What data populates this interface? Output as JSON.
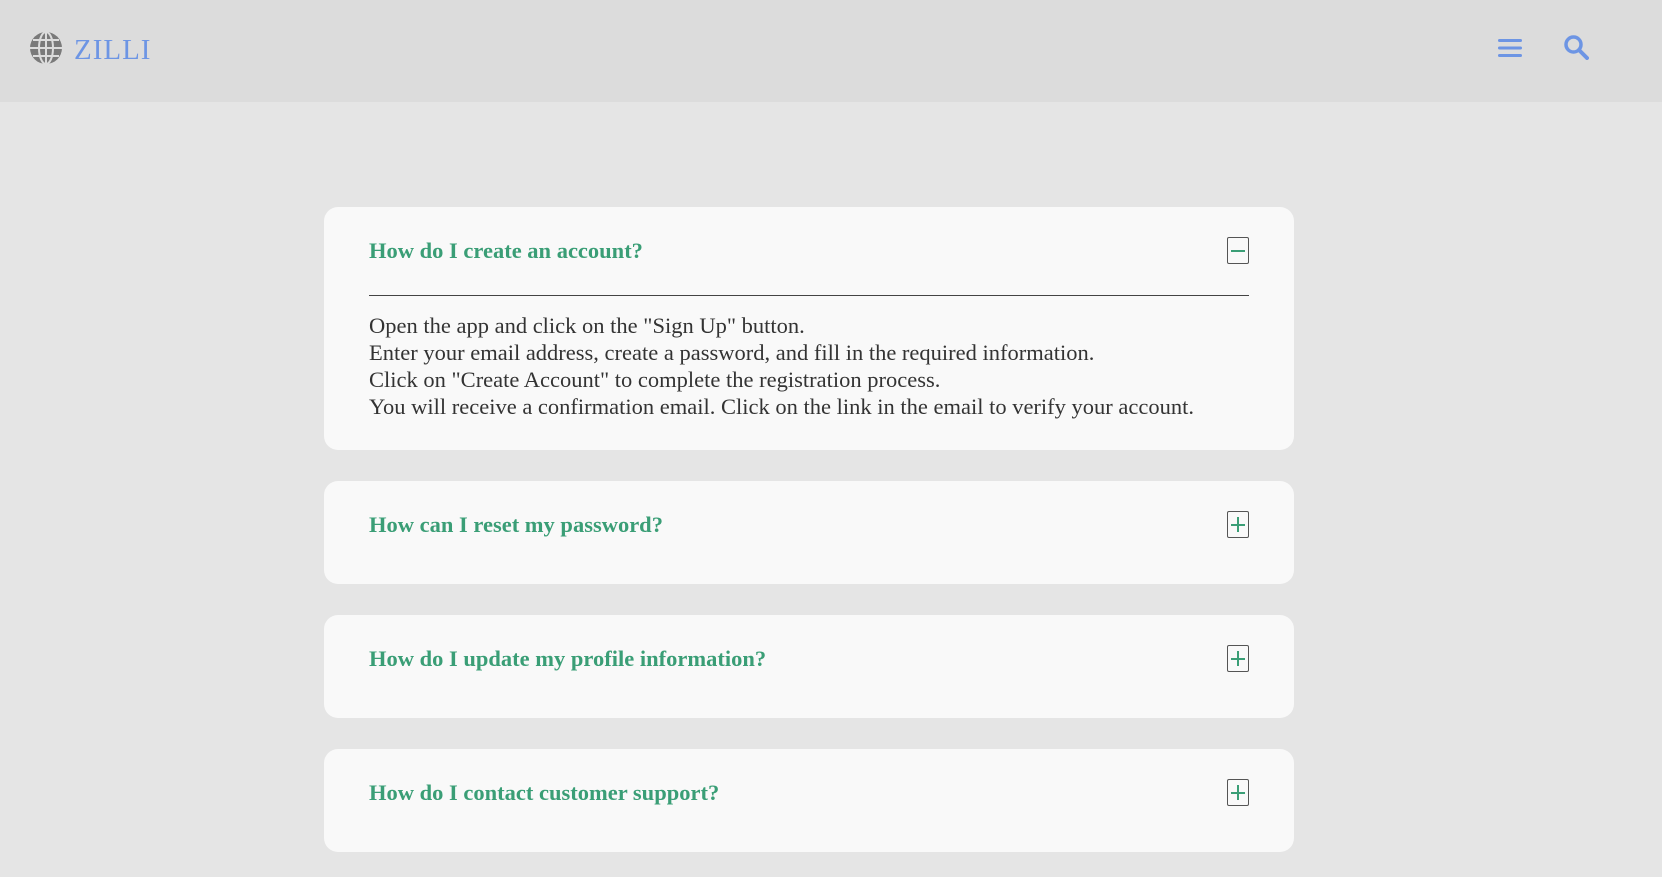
{
  "header": {
    "logo_text": "ZILLI",
    "logo_icon": "globe-icon",
    "menu_icon": "hamburger-menu-icon",
    "search_icon": "search-icon"
  },
  "colors": {
    "brand": "#6d95e4",
    "accent": "#3a9e76",
    "header_bg": "#dcdcdc",
    "page_bg": "#e5e5e5",
    "card_bg": "#f9f9f9"
  },
  "faq": [
    {
      "question": "How do I create an account?",
      "expanded": true,
      "answer": [
        "Open the app and click on the \"Sign Up\" button.",
        "Enter your email address, create a password, and fill in the required information.",
        "Click on \"Create Account\" to complete the registration process.",
        "You will receive a confirmation email. Click on the link in the email to verify your account."
      ]
    },
    {
      "question": "How can I reset my password?",
      "expanded": false
    },
    {
      "question": "How do I update my profile information?",
      "expanded": false
    },
    {
      "question": "How do I contact customer support?",
      "expanded": false
    }
  ]
}
